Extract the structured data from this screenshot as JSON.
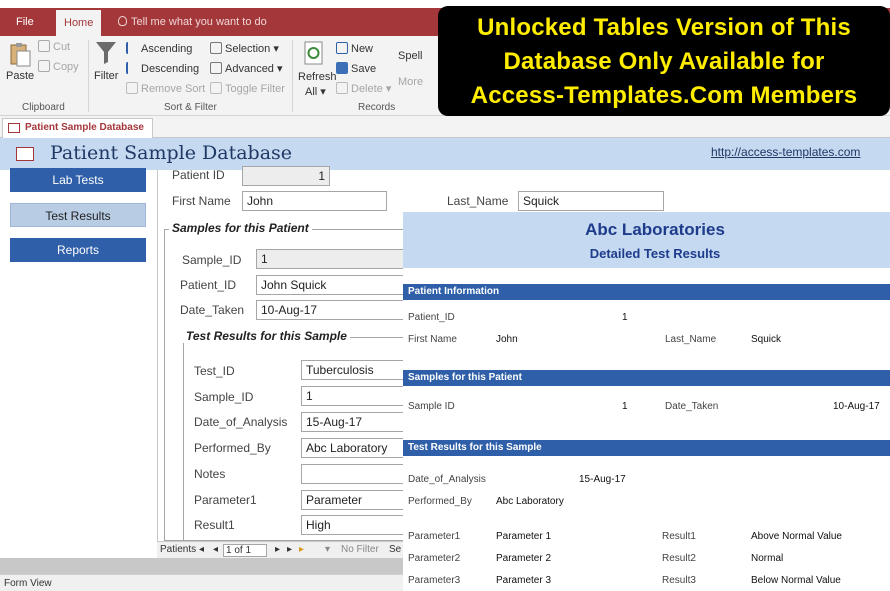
{
  "ribbon": {
    "tabs": [
      "File",
      "Home"
    ],
    "tell_me": "Tell me what you want to do",
    "clipboard": {
      "paste": "Paste",
      "cut": "Cut",
      "copy": "Copy",
      "label": "Clipboard"
    },
    "sort_filter": {
      "filter": "Filter",
      "ascending": "Ascending",
      "descending": "Descending",
      "remove_sort": "Remove Sort",
      "selection": "Selection",
      "advanced": "Advanced",
      "toggle_filter": "Toggle Filter",
      "label": "Sort & Filter"
    },
    "records": {
      "refresh": "Refresh",
      "all": "All",
      "new": "New",
      "save": "Save",
      "delete": "Delete",
      "spelling": "Spell",
      "more": "More",
      "label": "Records"
    }
  },
  "banner": {
    "line1": "Unlocked Tables Version of This",
    "line2": "Database Only Available for",
    "line3": "Access-Templates.Com Members"
  },
  "doc_tab": "Patient Sample Database",
  "header": {
    "title": "Patient Sample Database",
    "link": "http://access-templates.com"
  },
  "nav": {
    "lab_tests": "Lab Tests",
    "test_results": "Test Results",
    "reports": "Reports"
  },
  "form": {
    "patient_id_label": "Patient ID",
    "patient_id": "1",
    "first_name_label": "First Name",
    "first_name": "John",
    "last_name_label": "Last_Name",
    "last_name": "Squick",
    "samples_title": "Samples for this Patient",
    "sample_id_label": "Sample_ID",
    "sample_id": "1",
    "patient_id2_label": "Patient_ID",
    "patient_id2": "John Squick",
    "date_taken_label": "Date_Taken",
    "date_taken": "10-Aug-17",
    "tests_title": "Test Results for this Sample",
    "test_id_label": "Test_ID",
    "test_id": "Tuberculosis",
    "sample_id2_label": "Sample_ID",
    "sample_id2": "1",
    "date_analysis_label": "Date_of_Analysis",
    "date_analysis": "15-Aug-17",
    "performed_by_label": "Performed_By",
    "performed_by": "Abc Laboratory",
    "notes_label": "Notes",
    "notes": "",
    "parameter1_label": "Parameter1",
    "parameter1": "Parameter",
    "result1_label": "Result1",
    "result1": "High"
  },
  "record_nav": {
    "label": "Patients",
    "position": "1 of 1",
    "filter": "No Filter",
    "search": "Se"
  },
  "status": "Form View",
  "report": {
    "company": "Abc Laboratories",
    "subtitle": "Detailed Test Results",
    "patient_info": "Patient Information",
    "patient_id_label": "Patient_ID",
    "patient_id": "1",
    "first_name_label": "First Name",
    "first_name": "John",
    "last_name_label": "Last_Name",
    "last_name": "Squick",
    "samples_title": "Samples for this Patient",
    "sample_id_label": "Sample ID",
    "sample_id": "1",
    "date_taken_label": "Date_Taken",
    "date_taken": "10-Aug-17",
    "tests_title": "Test Results for this Sample",
    "date_analysis_label": "Date_of_Analysis",
    "date_analysis": "15-Aug-17",
    "performed_by_label": "Performed_By",
    "performed_by": "Abc Laboratory",
    "rows": [
      {
        "plabel": "Parameter1",
        "pvalue": "Parameter 1",
        "rlabel": "Result1",
        "rvalue": "Above Normal Value"
      },
      {
        "plabel": "Parameter2",
        "pvalue": "Parameter 2",
        "rlabel": "Result2",
        "rvalue": "Normal"
      },
      {
        "plabel": "Parameter3",
        "pvalue": "Parameter 3",
        "rlabel": "Result3",
        "rvalue": "Below Normal Value"
      }
    ]
  },
  "colors": {
    "ribbon_accent": "#a4373a",
    "banner_bg": "#000000",
    "banner_text": "#ffed00",
    "header_bg": "#c5d9f1",
    "report_bar": "#2e5fa8"
  }
}
